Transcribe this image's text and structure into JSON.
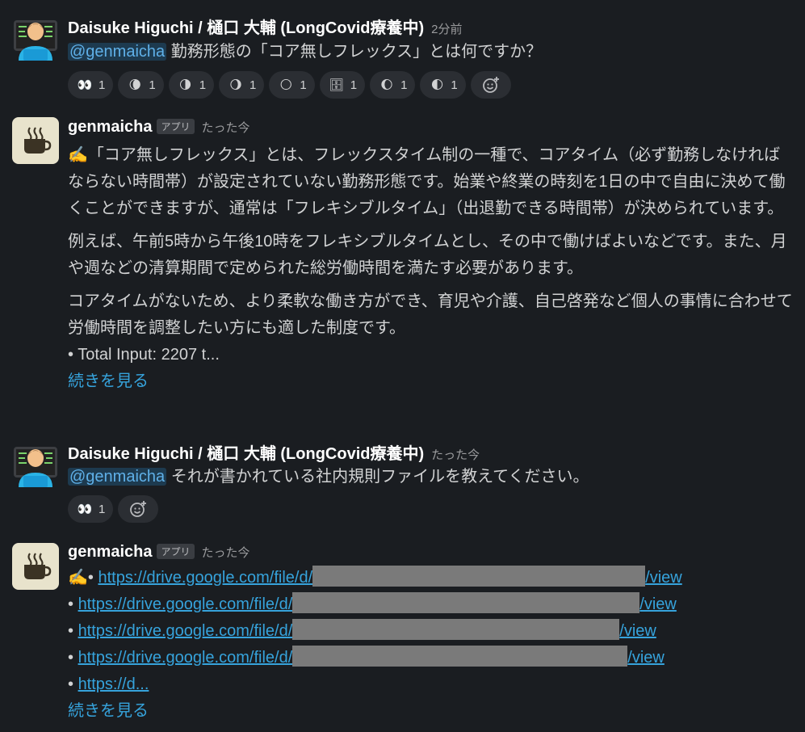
{
  "messages": [
    {
      "author": "Daisuke Higuchi / 樋口 大輔 (LongCovid療養中)",
      "time": "2分前",
      "mention": "@genmaicha",
      "text": "勤務形態の「コア無しフレックス」とは何ですか？",
      "reactions": [
        {
          "icon": "eyes-icon",
          "glyph": "👀",
          "count": "1"
        },
        {
          "icon": "moon-crescent-icon",
          "glyph": "🌘",
          "count": "1"
        },
        {
          "icon": "moon-half-icon",
          "glyph": "🌗",
          "count": "1"
        },
        {
          "icon": "moon-gibbous-icon",
          "glyph": "🌖",
          "count": "1"
        },
        {
          "icon": "full-moon-icon",
          "glyph": "🌕",
          "count": "1"
        },
        {
          "icon": "file-cabinet-icon",
          "glyph": "🗄",
          "count": "1"
        },
        {
          "icon": "moon-waxing-gibbous-icon",
          "glyph": "🌔",
          "count": "1"
        },
        {
          "icon": "moon-first-quarter-icon",
          "glyph": "🌓",
          "count": "1"
        }
      ]
    },
    {
      "author": "genmaicha",
      "badge": "アプリ",
      "time": "たった今",
      "p1": "✍️「コア無しフレックス」とは、フレックスタイム制の一種で、コアタイム（必ず勤務しなければならない時間帯）が設定されていない勤務形態です。始業や終業の時刻を1日の中で自由に決めて働くことができますが、通常は「フレキシブルタイム」（出退勤できる時間帯）が決められています。",
      "p2": "例えば、午前5時から午後10時をフレキシブルタイムとし、その中で働けばよいなどです。また、月や週などの清算期間で定められた総労働時間を満たす必要があります。",
      "p3": "コアタイムがないため、より柔軟な働き方ができ、育児や介護、自己啓発など個人の事情に合わせて労働時間を調整したい方にも適した制度です。",
      "bullet": "• Total Input: 2207 t...",
      "more": "続きを見る"
    },
    {
      "author": "Daisuke Higuchi / 樋口 大輔 (LongCovid療養中)",
      "time": "たった今",
      "mention": "@genmaicha",
      "text": "それが書かれている社内規則ファイルを教えてください。",
      "reactions": [
        {
          "icon": "eyes-icon",
          "glyph": "👀",
          "count": "1"
        }
      ]
    },
    {
      "author": "genmaicha",
      "badge": "アプリ",
      "time": "たった今",
      "links": [
        {
          "prefix": "✍️• ",
          "start": "https://drive.google.com/file/d/",
          "end": "/view"
        },
        {
          "prefix": "• ",
          "start": "https://drive.google.com/file/d/",
          "end": "/view"
        },
        {
          "prefix": "• ",
          "start": "https://drive.google.com/file/d/",
          "end": "/view"
        },
        {
          "prefix": "• ",
          "start": "https://drive.google.com/file/d/",
          "end": "/view"
        },
        {
          "prefix": "• ",
          "start": "https://d...",
          "end": ""
        }
      ],
      "more": "続きを見る"
    }
  ]
}
